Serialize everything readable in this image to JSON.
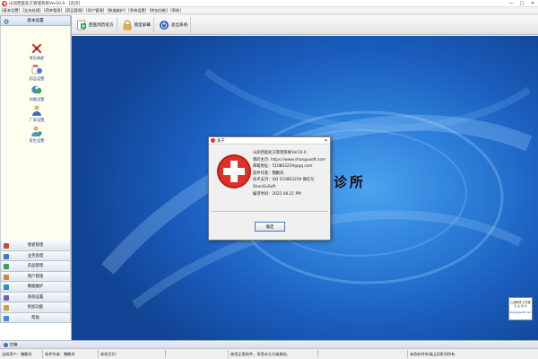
{
  "window": {
    "title": "山润西医处方管理系统Ver10.0 - [首页]",
    "controls": {
      "minimize": "—",
      "maximize": "□",
      "close": "✕"
    }
  },
  "menu": [
    "[基本设置]",
    "[业务处理]",
    "[药库管理]",
    "[药品管理]",
    "[用户管理]",
    "[数据维护]",
    "[系统设置]",
    "[附加功能]",
    "[帮助]"
  ],
  "toolbar": [
    {
      "label": "西医简历处方",
      "icon": "prescription-icon"
    },
    {
      "label": "锁定屏幕",
      "icon": "lock-screen-icon"
    },
    {
      "label": "退出系统",
      "icon": "exit-icon"
    }
  ],
  "sidebar": {
    "header": "基本设置",
    "entries": [
      {
        "label": "常见病症",
        "icon": "symptoms-icon"
      },
      {
        "label": "药品设置",
        "icon": "medicine-settings-icon"
      },
      {
        "label": "剂量设置",
        "icon": "dosage-settings-icon"
      },
      {
        "label": "厂家设置",
        "icon": "manufacturer-settings-icon"
      },
      {
        "label": "医生设置",
        "icon": "doctor-settings-icon"
      }
    ],
    "sections": [
      {
        "label": "患者管理",
        "color": "#c24a3a"
      },
      {
        "label": "业务处理",
        "color": "#3b78c9"
      },
      {
        "label": "药品管理",
        "color": "#3aa256"
      },
      {
        "label": "用户管理",
        "color": "#d08a2a"
      },
      {
        "label": "数据维护",
        "color": "#2f8fb8"
      },
      {
        "label": "系统设置",
        "color": "#7a5bb8"
      },
      {
        "label": "附加功能",
        "color": "#c9a227"
      },
      {
        "label": "帮助",
        "color": "#4a88d8"
      }
    ]
  },
  "desktop": {
    "brand_text": "诊所",
    "corner_logo": {
      "line1": "山润软件工作室",
      "line2": "专 业 软 件",
      "line3": "shangusoft.com"
    }
  },
  "about_dialog": {
    "title": "关于",
    "lines": [
      "山润西医处方管理系统Ver10.0",
      "我的主页: https://www.shangusoft.com",
      "邮箱地址：510863259@qq.com",
      "软件作者：魏鹏风",
      "技术支持：QQ 510863259 微信号",
      "ShanGuSoft",
      "编译时间：2021.08.21 PM"
    ],
    "ok_label": "确定"
  },
  "subbar": {
    "label": "信箱"
  },
  "status": [
    "当前用户：魏鹏风",
    "软件作者：魏鹏风",
    "本机识识：",
    "",
    "使用正版软件，享受永久升级服务。",
    "",
    "本款软件申请山润系列所有"
  ],
  "colors": {
    "accent": "#e0302a",
    "desktop": "#2c7ed9",
    "sidebar_panel": "#ffffef"
  }
}
